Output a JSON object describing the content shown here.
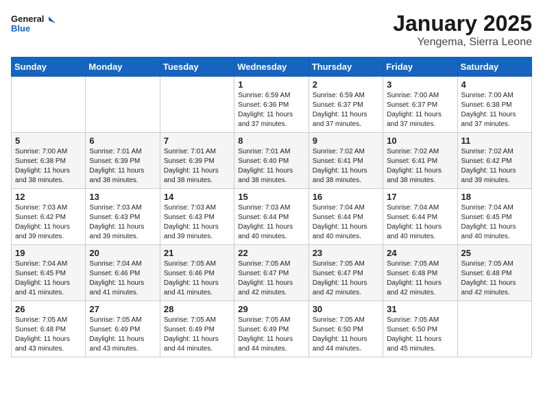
{
  "header": {
    "logo_line1": "General",
    "logo_line2": "Blue",
    "month": "January 2025",
    "location": "Yengema, Sierra Leone"
  },
  "weekdays": [
    "Sunday",
    "Monday",
    "Tuesday",
    "Wednesday",
    "Thursday",
    "Friday",
    "Saturday"
  ],
  "weeks": [
    [
      {
        "day": "",
        "info": ""
      },
      {
        "day": "",
        "info": ""
      },
      {
        "day": "",
        "info": ""
      },
      {
        "day": "1",
        "info": "Sunrise: 6:59 AM\nSunset: 6:36 PM\nDaylight: 11 hours\nand 37 minutes."
      },
      {
        "day": "2",
        "info": "Sunrise: 6:59 AM\nSunset: 6:37 PM\nDaylight: 11 hours\nand 37 minutes."
      },
      {
        "day": "3",
        "info": "Sunrise: 7:00 AM\nSunset: 6:37 PM\nDaylight: 11 hours\nand 37 minutes."
      },
      {
        "day": "4",
        "info": "Sunrise: 7:00 AM\nSunset: 6:38 PM\nDaylight: 11 hours\nand 37 minutes."
      }
    ],
    [
      {
        "day": "5",
        "info": "Sunrise: 7:00 AM\nSunset: 6:38 PM\nDaylight: 11 hours\nand 38 minutes."
      },
      {
        "day": "6",
        "info": "Sunrise: 7:01 AM\nSunset: 6:39 PM\nDaylight: 11 hours\nand 38 minutes."
      },
      {
        "day": "7",
        "info": "Sunrise: 7:01 AM\nSunset: 6:39 PM\nDaylight: 11 hours\nand 38 minutes."
      },
      {
        "day": "8",
        "info": "Sunrise: 7:01 AM\nSunset: 6:40 PM\nDaylight: 11 hours\nand 38 minutes."
      },
      {
        "day": "9",
        "info": "Sunrise: 7:02 AM\nSunset: 6:41 PM\nDaylight: 11 hours\nand 38 minutes."
      },
      {
        "day": "10",
        "info": "Sunrise: 7:02 AM\nSunset: 6:41 PM\nDaylight: 11 hours\nand 38 minutes."
      },
      {
        "day": "11",
        "info": "Sunrise: 7:02 AM\nSunset: 6:42 PM\nDaylight: 11 hours\nand 39 minutes."
      }
    ],
    [
      {
        "day": "12",
        "info": "Sunrise: 7:03 AM\nSunset: 6:42 PM\nDaylight: 11 hours\nand 39 minutes."
      },
      {
        "day": "13",
        "info": "Sunrise: 7:03 AM\nSunset: 6:43 PM\nDaylight: 11 hours\nand 39 minutes."
      },
      {
        "day": "14",
        "info": "Sunrise: 7:03 AM\nSunset: 6:43 PM\nDaylight: 11 hours\nand 39 minutes."
      },
      {
        "day": "15",
        "info": "Sunrise: 7:03 AM\nSunset: 6:44 PM\nDaylight: 11 hours\nand 40 minutes."
      },
      {
        "day": "16",
        "info": "Sunrise: 7:04 AM\nSunset: 6:44 PM\nDaylight: 11 hours\nand 40 minutes."
      },
      {
        "day": "17",
        "info": "Sunrise: 7:04 AM\nSunset: 6:44 PM\nDaylight: 11 hours\nand 40 minutes."
      },
      {
        "day": "18",
        "info": "Sunrise: 7:04 AM\nSunset: 6:45 PM\nDaylight: 11 hours\nand 40 minutes."
      }
    ],
    [
      {
        "day": "19",
        "info": "Sunrise: 7:04 AM\nSunset: 6:45 PM\nDaylight: 11 hours\nand 41 minutes."
      },
      {
        "day": "20",
        "info": "Sunrise: 7:04 AM\nSunset: 6:46 PM\nDaylight: 11 hours\nand 41 minutes."
      },
      {
        "day": "21",
        "info": "Sunrise: 7:05 AM\nSunset: 6:46 PM\nDaylight: 11 hours\nand 41 minutes."
      },
      {
        "day": "22",
        "info": "Sunrise: 7:05 AM\nSunset: 6:47 PM\nDaylight: 11 hours\nand 42 minutes."
      },
      {
        "day": "23",
        "info": "Sunrise: 7:05 AM\nSunset: 6:47 PM\nDaylight: 11 hours\nand 42 minutes."
      },
      {
        "day": "24",
        "info": "Sunrise: 7:05 AM\nSunset: 6:48 PM\nDaylight: 11 hours\nand 42 minutes."
      },
      {
        "day": "25",
        "info": "Sunrise: 7:05 AM\nSunset: 6:48 PM\nDaylight: 11 hours\nand 42 minutes."
      }
    ],
    [
      {
        "day": "26",
        "info": "Sunrise: 7:05 AM\nSunset: 6:48 PM\nDaylight: 11 hours\nand 43 minutes."
      },
      {
        "day": "27",
        "info": "Sunrise: 7:05 AM\nSunset: 6:49 PM\nDaylight: 11 hours\nand 43 minutes."
      },
      {
        "day": "28",
        "info": "Sunrise: 7:05 AM\nSunset: 6:49 PM\nDaylight: 11 hours\nand 44 minutes."
      },
      {
        "day": "29",
        "info": "Sunrise: 7:05 AM\nSunset: 6:49 PM\nDaylight: 11 hours\nand 44 minutes."
      },
      {
        "day": "30",
        "info": "Sunrise: 7:05 AM\nSunset: 6:50 PM\nDaylight: 11 hours\nand 44 minutes."
      },
      {
        "day": "31",
        "info": "Sunrise: 7:05 AM\nSunset: 6:50 PM\nDaylight: 11 hours\nand 45 minutes."
      },
      {
        "day": "",
        "info": ""
      }
    ]
  ]
}
